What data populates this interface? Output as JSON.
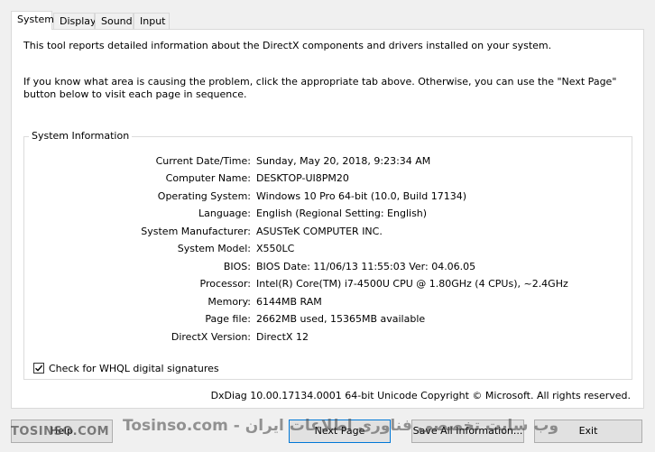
{
  "tabs": [
    "System",
    "Display",
    "Sound",
    "Input"
  ],
  "intro": {
    "line1": "This tool reports detailed information about the DirectX components and drivers installed on your system.",
    "line2": "If you know what area is causing the problem, click the appropriate tab above.  Otherwise, you can use the \"Next Page\" button below to visit each page in sequence."
  },
  "system_info": {
    "title": "System Information",
    "rows": [
      {
        "label": "Current Date/Time:",
        "value": "Sunday, May 20, 2018, 9:23:34 AM"
      },
      {
        "label": "Computer Name:",
        "value": "DESKTOP-UI8PM20"
      },
      {
        "label": "Operating System:",
        "value": "Windows 10 Pro 64-bit (10.0, Build 17134)"
      },
      {
        "label": "Language:",
        "value": "English (Regional Setting: English)"
      },
      {
        "label": "System Manufacturer:",
        "value": "ASUSTeK COMPUTER INC."
      },
      {
        "label": "System Model:",
        "value": "X550LC"
      },
      {
        "label": "BIOS:",
        "value": "BIOS Date: 11/06/13 11:55:03 Ver: 04.06.05"
      },
      {
        "label": "Processor:",
        "value": "Intel(R) Core(TM) i7-4500U CPU @ 1.80GHz (4 CPUs), ~2.4GHz"
      },
      {
        "label": "Memory:",
        "value": "6144MB RAM"
      },
      {
        "label": "Page file:",
        "value": "2662MB used, 15365MB available"
      },
      {
        "label": "DirectX Version:",
        "value": "DirectX 12"
      }
    ]
  },
  "whql": {
    "label": "Check for WHQL digital signatures",
    "checked": true
  },
  "footer": "DxDiag 10.00.17134.0001 64-bit Unicode  Copyright © Microsoft. All rights reserved.",
  "buttons": {
    "help": "Help",
    "next_page": "Next Page",
    "save_all": "Save All Information...",
    "exit": "Exit"
  },
  "watermark": {
    "left": "TOSINSO.COM",
    "mid": "وب سایت تخصصی فناوری اطلاعات ایران - Tosinso.com"
  }
}
